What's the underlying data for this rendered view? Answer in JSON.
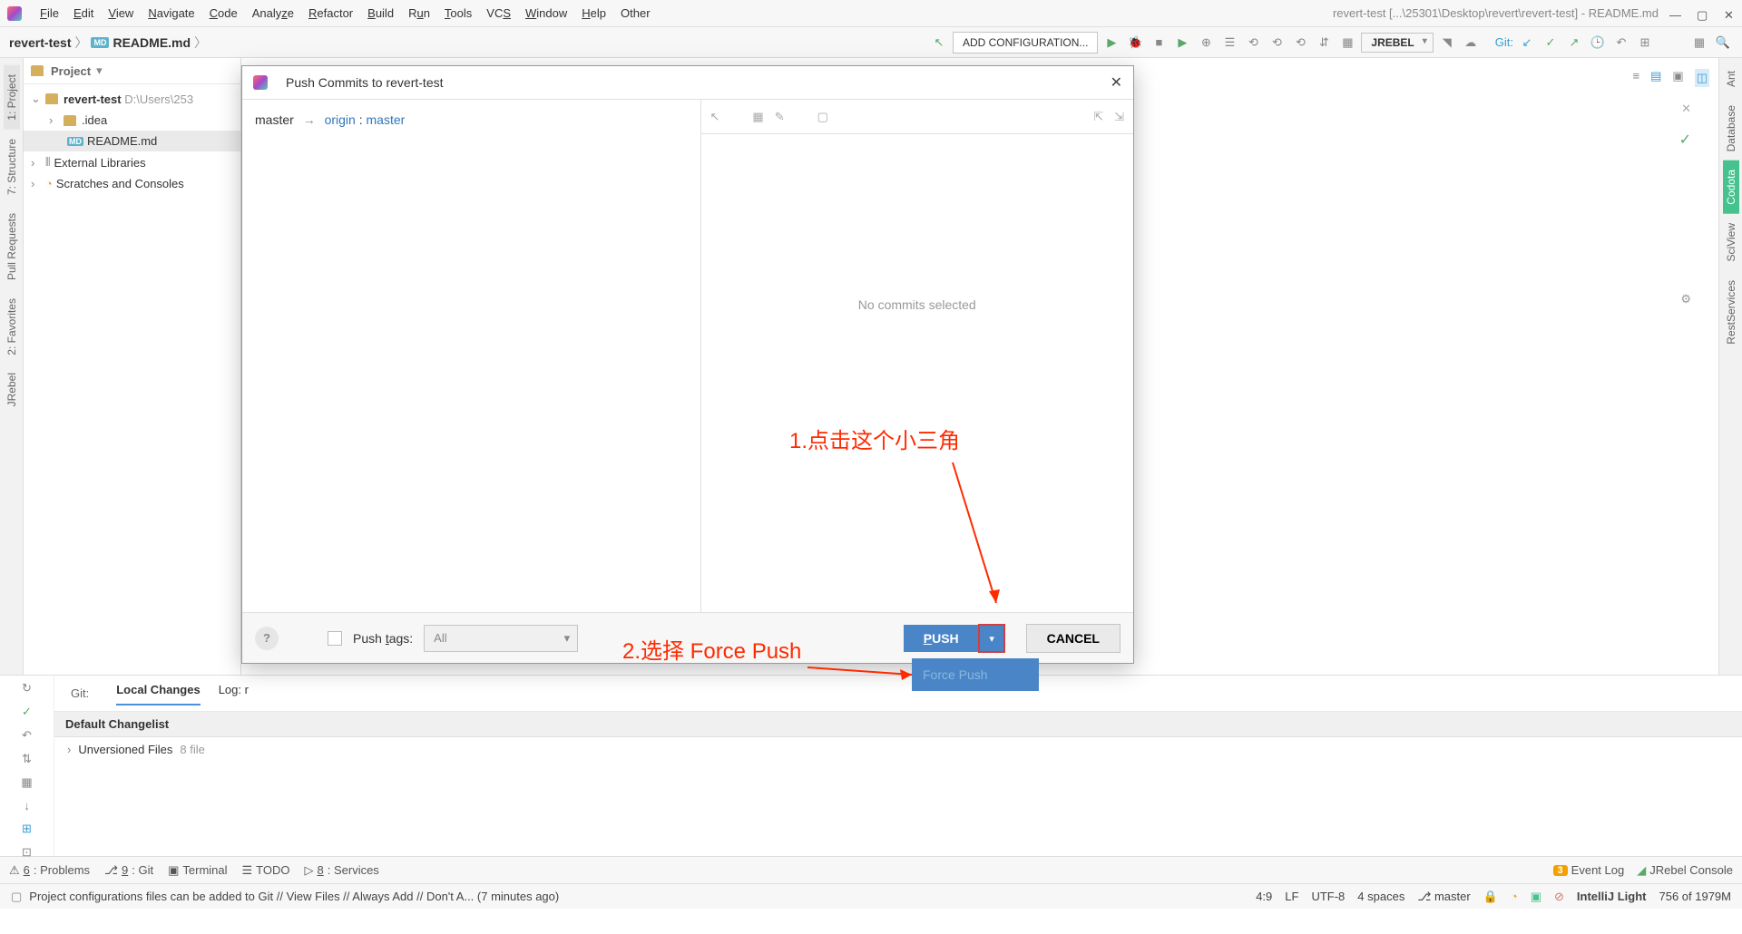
{
  "window": {
    "title": "revert-test [...\\25301\\Desktop\\revert\\revert-test] - README.md"
  },
  "menubar": {
    "items": [
      "File",
      "Edit",
      "View",
      "Navigate",
      "Code",
      "Analyze",
      "Refactor",
      "Build",
      "Run",
      "Tools",
      "VCS",
      "Window",
      "Help",
      "Other"
    ]
  },
  "breadcrumb": {
    "project": "revert-test",
    "file": "README.md"
  },
  "toolbar": {
    "run_config": "ADD CONFIGURATION...",
    "jrebel": "JREBEL",
    "git_label": "Git:"
  },
  "project_panel": {
    "title": "Project",
    "root": "revert-test",
    "root_path": "D:\\Users\\253",
    "idea": ".idea",
    "readme": "README.md",
    "ext_libs": "External Libraries",
    "scratches": "Scratches and Consoles"
  },
  "left_rail": {
    "project": "1: Project",
    "structure": "7: Structure",
    "pull_requests": "Pull Requests",
    "favorites": "2: Favorites",
    "jrebel": "JRebel"
  },
  "right_rail": {
    "ant": "Ant",
    "database": "Database",
    "codota": "Codota",
    "sciview": "SciView",
    "rest": "RestServices"
  },
  "git_panel": {
    "git_label": "Git:",
    "tab_local": "Local Changes",
    "tab_log": "Log: r",
    "default_changelist": "Default Changelist",
    "unversioned": "Unversioned Files",
    "unversioned_count": "8 file"
  },
  "dialog": {
    "title": "Push Commits to revert-test",
    "branch_local": "master",
    "branch_origin": "origin",
    "branch_remote": "master",
    "no_commits": "No commits selected",
    "push_tags_label": "Push tags:",
    "tags_option": "All",
    "push_btn": "PUSH",
    "cancel_btn": "CANCEL",
    "force_push": "Force Push"
  },
  "bottom": {
    "problems": "6: Problems",
    "git": "9: Git",
    "terminal": "Terminal",
    "todo": "TODO",
    "services": "8: Services",
    "event_log": "Event Log",
    "event_count": "3",
    "jrebel": "JRebel Console"
  },
  "status": {
    "msg": "Project configurations files can be added to Git // View Files // Always Add // Don't A... (7 minutes ago)",
    "pos": "4:9",
    "lf": "LF",
    "encoding": "UTF-8",
    "indent": "4 spaces",
    "branch": "master",
    "ide": "IntelliJ Light",
    "mem": "756 of 1979M"
  },
  "annotations": {
    "a1": "1.点击这个小三角",
    "a2": "2.选择 Force Push"
  }
}
